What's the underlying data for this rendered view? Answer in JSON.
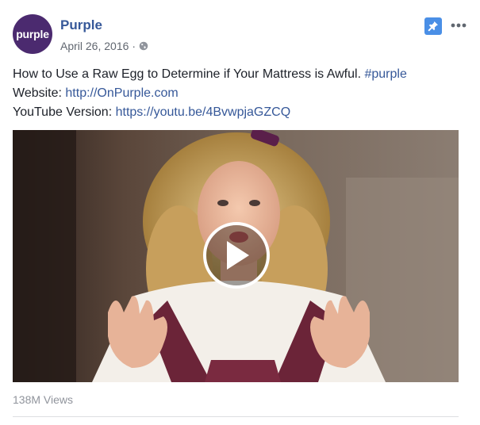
{
  "post": {
    "page_name": "Purple",
    "avatar_text": "purple",
    "date": "April 26, 2016",
    "separator": "·",
    "text_line1_main": "How to Use a Raw Egg to Determine if Your Mattress is Awful.",
    "hashtag": "#purple",
    "website_label": "Website:",
    "website_link": "http://OnPurple.com",
    "youtube_label": "YouTube Version:",
    "youtube_link": "https://youtu.be/4BvwpjaGZCQ",
    "views": "138M Views"
  },
  "icons": {
    "globe": "globe-icon",
    "pin": "pin-icon",
    "more": "more-options-icon",
    "play": "play-icon"
  },
  "colors": {
    "link": "#365899",
    "avatar_bg": "#4b2a6f",
    "pin_bg": "#4a8fe6",
    "muted": "#90949c"
  }
}
